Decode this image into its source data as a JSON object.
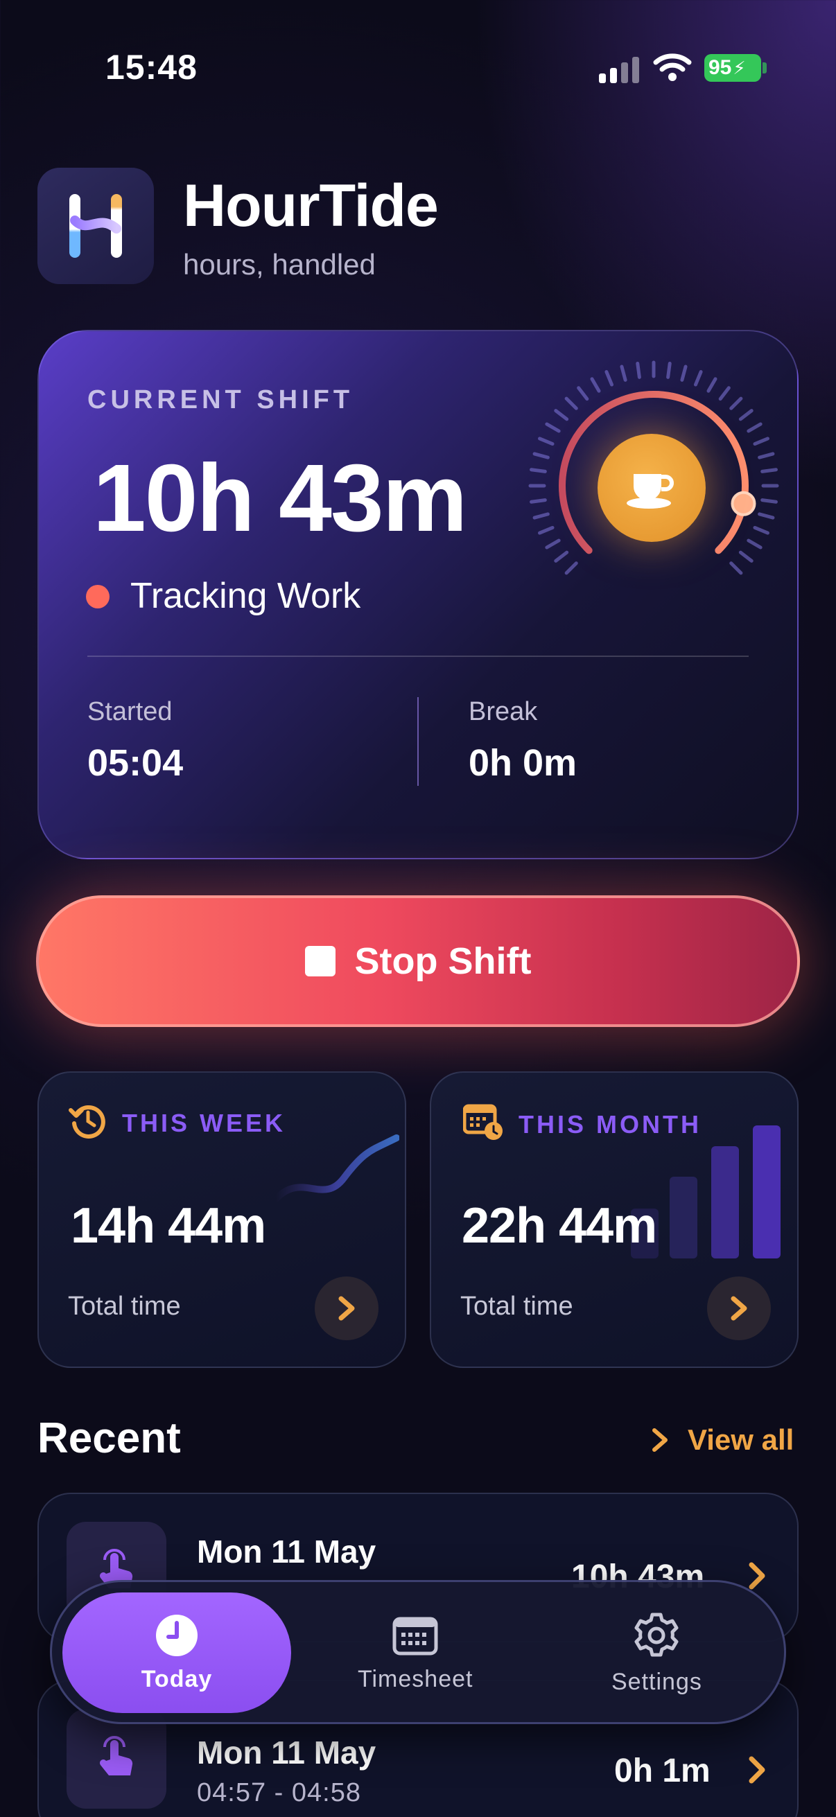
{
  "status_bar": {
    "time": "15:48",
    "battery": "95"
  },
  "header": {
    "title": "HourTide",
    "subtitle": "hours, handled"
  },
  "current_shift": {
    "eyebrow": "CURRENT SHIFT",
    "elapsed": "10h 43m",
    "status": "Tracking Work",
    "started_label": "Started",
    "started_value": "05:04",
    "break_label": "Break",
    "break_value": "0h 0m",
    "ring_progress": 0.45
  },
  "stop_button": {
    "label": "Stop Shift"
  },
  "stats": {
    "week": {
      "label": "THIS WEEK",
      "value": "14h 44m",
      "sub": "Total time"
    },
    "month": {
      "label": "THIS MONTH",
      "value": "22h 44m",
      "sub": "Total time"
    }
  },
  "recent": {
    "title": "Recent",
    "view_all": "View all",
    "items": [
      {
        "date": "Mon 11 May",
        "range": "",
        "duration": "10h 43m"
      },
      {
        "date": "Mon 11 May",
        "range": "04:57 - 04:58",
        "duration": "0h 1m"
      }
    ]
  },
  "tabbar": {
    "today": "Today",
    "timesheet": "Timesheet",
    "settings": "Settings"
  },
  "colors": {
    "accent_purple": "#8b5cf6",
    "accent_orange": "#f0a646",
    "stop_red": "#ef4a5e",
    "tracking_dot": "#ff6a5b"
  }
}
